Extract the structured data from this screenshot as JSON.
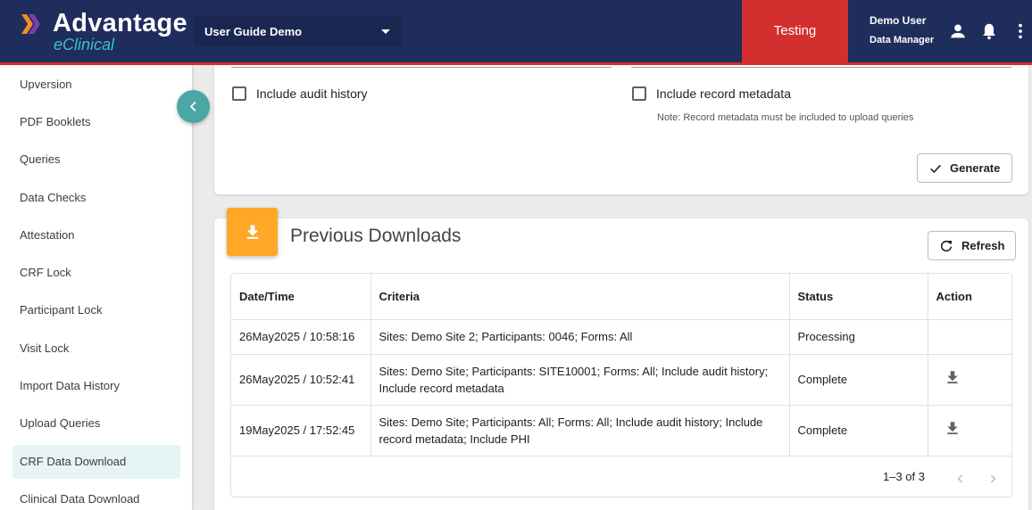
{
  "header": {
    "brand": "Advantage",
    "brand_sub": "eClinical",
    "study": "User Guide Demo",
    "environment": "Testing",
    "user_name": "Demo User",
    "user_role": "Data Manager",
    "colors": {
      "navy": "#1f2d5c",
      "red": "#d32f2f",
      "teal": "#36c2c8",
      "orange": "#ffa726"
    }
  },
  "sidebar": {
    "items": [
      {
        "label": "Upversion"
      },
      {
        "label": "PDF Booklets"
      },
      {
        "label": "Queries"
      },
      {
        "label": "Data Checks"
      },
      {
        "label": "Attestation"
      },
      {
        "label": "CRF Lock"
      },
      {
        "label": "Participant Lock"
      },
      {
        "label": "Visit Lock"
      },
      {
        "label": "Import Data History"
      },
      {
        "label": "Upload Queries"
      },
      {
        "label": "CRF Data Download"
      },
      {
        "label": "Clinical Data Download"
      }
    ],
    "active": "CRF Data Download"
  },
  "options": {
    "include_audit_history": "Include audit history",
    "include_record_metadata": "Include record metadata",
    "note": "Note: Record metadata must be included to upload queries",
    "generate_label": "Generate"
  },
  "downloads": {
    "title": "Previous Downloads",
    "refresh_label": "Refresh",
    "columns": [
      "Date/Time",
      "Criteria",
      "Status",
      "Action"
    ],
    "rows": [
      {
        "datetime": "26May2025 / 10:58:16",
        "criteria": "Sites: Demo Site 2; Participants: 0046; Forms: All",
        "status": "Processing",
        "action": ""
      },
      {
        "datetime": "26May2025 / 10:52:41",
        "criteria": "Sites: Demo Site; Participants: SITE10001; Forms: All; Include audit history; Include record metadata",
        "status": "Complete",
        "action": "download-icon"
      },
      {
        "datetime": "19May2025 / 17:52:45",
        "criteria": "Sites: Demo Site; Participants: All; Forms: All; Include audit history; Include record metadata; Include PHI",
        "status": "Complete",
        "action": "download-icon"
      }
    ],
    "pagination": "1–3 of 3"
  }
}
